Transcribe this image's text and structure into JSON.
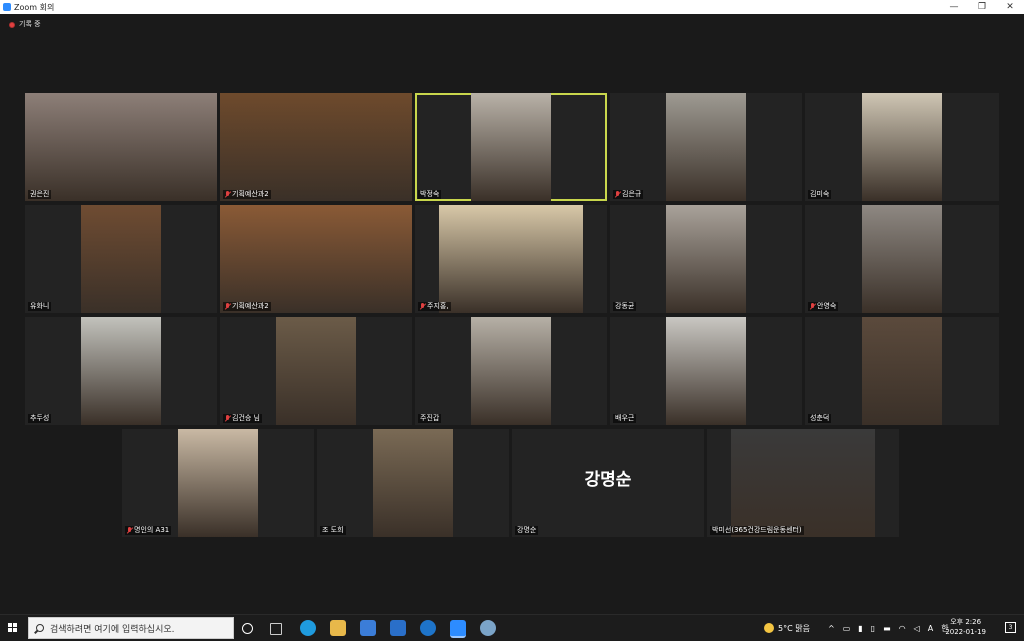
{
  "window": {
    "title": "Zoom 회의",
    "minimize": "—",
    "restore": "❐",
    "close": "✕"
  },
  "recording": {
    "label": "기록 중"
  },
  "participants": [
    {
      "name": "권은진",
      "muted": false,
      "active": false,
      "bg": "#8d7f78"
    },
    {
      "name": "기획예산과2",
      "muted": true,
      "active": false,
      "bg": "#6e4a2c"
    },
    {
      "name": "박정숙",
      "muted": false,
      "active": true,
      "bg": "#b9b2a8"
    },
    {
      "name": "김은규",
      "muted": true,
      "active": false,
      "bg": "#9e9a92"
    },
    {
      "name": "김미숙",
      "muted": false,
      "active": false,
      "bg": "#cfc6b4"
    },
    {
      "name": "유화니",
      "muted": false,
      "active": false,
      "bg": "#6f4c32"
    },
    {
      "name": "기획예산과2",
      "muted": true,
      "active": false,
      "bg": "#8a5a36"
    },
    {
      "name": "주지홍,",
      "muted": true,
      "active": false,
      "bg": "#d8c8a8"
    },
    {
      "name": "강동균",
      "muted": false,
      "active": false,
      "bg": "#a9a29a"
    },
    {
      "name": "안영숙",
      "muted": true,
      "active": false,
      "bg": "#8e8882"
    },
    {
      "name": "추두성",
      "muted": false,
      "active": false,
      "bg": "#c2c2bc"
    },
    {
      "name": "김건승 님",
      "muted": true,
      "active": false,
      "bg": "#6b5b48"
    },
    {
      "name": "주진갑",
      "muted": false,
      "active": false,
      "bg": "#b6b0a6"
    },
    {
      "name": "배우근",
      "muted": false,
      "active": false,
      "bg": "#c9c7c2"
    },
    {
      "name": "성춘덕",
      "muted": false,
      "active": false,
      "bg": "#5b4a3c"
    },
    {
      "name": "명인의 A31",
      "muted": true,
      "active": false,
      "bg": "#c9b9a4"
    },
    {
      "name": "조 도희",
      "muted": false,
      "active": false,
      "bg": "#7a6a55"
    },
    {
      "name": "강명순",
      "muted": false,
      "active": false,
      "bg": "",
      "bigname": "강명순"
    },
    {
      "name": "박미선(365건강드림운동센터)",
      "muted": false,
      "active": false,
      "bg": "#3a3a3a"
    }
  ],
  "taskbar": {
    "search_placeholder": "검색하려면 여기에 입력하십시오.",
    "weather": "5°C 맑음",
    "time": "오후 2:26",
    "date": "2022-01-19",
    "notifications": "3",
    "lang": "A",
    "ime": "한"
  }
}
